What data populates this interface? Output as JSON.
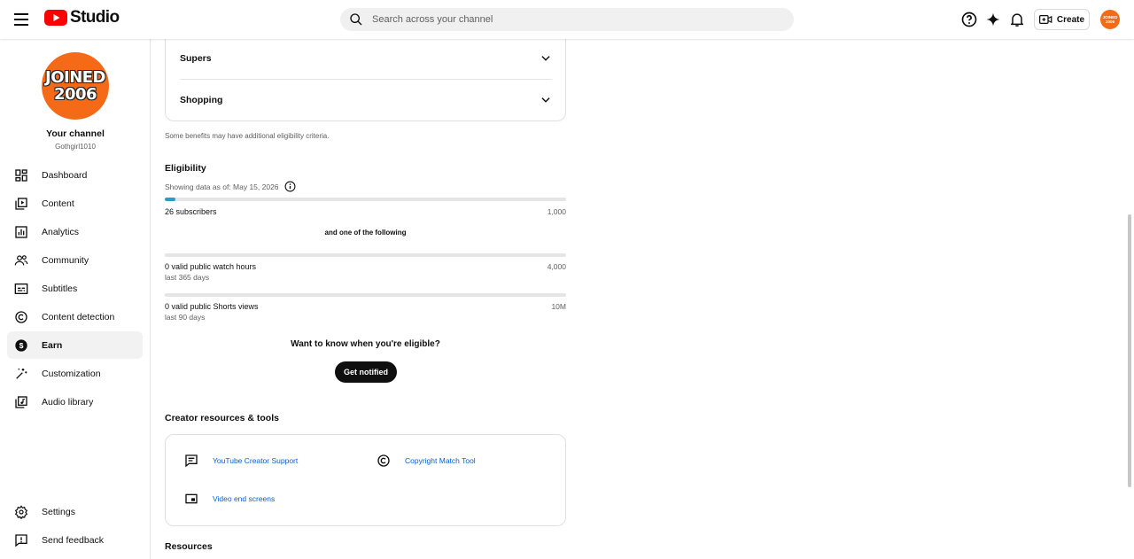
{
  "header": {
    "app_name": "Studio",
    "search_placeholder": "Search across your channel",
    "create_label": "Create",
    "avatar_line1": "JOINED",
    "avatar_line2": "2006"
  },
  "sidebar": {
    "channel_avatar_line1": "JOINED",
    "channel_avatar_line2": "2006",
    "channel_title": "Your channel",
    "channel_handle": "Gothgirl1010",
    "items": [
      {
        "label": "Dashboard",
        "icon": "dashboard-icon"
      },
      {
        "label": "Content",
        "icon": "content-icon"
      },
      {
        "label": "Analytics",
        "icon": "analytics-icon"
      },
      {
        "label": "Community",
        "icon": "community-icon"
      },
      {
        "label": "Subtitles",
        "icon": "subtitles-icon"
      },
      {
        "label": "Content detection",
        "icon": "copyright-icon"
      },
      {
        "label": "Earn",
        "icon": "dollar-icon",
        "active": true
      },
      {
        "label": "Customization",
        "icon": "magic-wand-icon"
      },
      {
        "label": "Audio library",
        "icon": "audio-library-icon"
      }
    ],
    "bottom_items": [
      {
        "label": "Settings",
        "icon": "gear-icon"
      },
      {
        "label": "Send feedback",
        "icon": "feedback-icon"
      }
    ]
  },
  "benefits": {
    "rows": [
      "Supers",
      "Shopping"
    ],
    "note": "Some benefits may have additional eligibility criteria."
  },
  "eligibility": {
    "title": "Eligibility",
    "data_as_of": "Showing data as of: May 15, 2026",
    "subscribers": {
      "label": "26 subscribers",
      "goal": "1,000",
      "progress": 0.026
    },
    "connector": "and one of the following",
    "watch_hours": {
      "label": "0 valid public watch hours",
      "sub": "last 365 days",
      "goal": "4,000",
      "progress": 0
    },
    "shorts_views": {
      "label": "0 valid public Shorts views",
      "sub": "last 90 days",
      "goal": "10M",
      "progress": 0
    },
    "notify_prompt": "Want to know when you're eligible?",
    "notify_button": "Get notified"
  },
  "creator_resources": {
    "title": "Creator resources & tools",
    "links": [
      {
        "label": "YouTube Creator Support",
        "icon": "chat-support-icon"
      },
      {
        "label": "Copyright Match Tool",
        "icon": "copyright-icon"
      },
      {
        "label": "Video end screens",
        "icon": "end-screen-icon"
      }
    ]
  },
  "resources_title": "Resources",
  "colors": {
    "brand_red": "#ff0000",
    "avatar_orange": "#f46a17",
    "progress_blue": "#2e9ac7",
    "link_blue": "#065fd4"
  }
}
